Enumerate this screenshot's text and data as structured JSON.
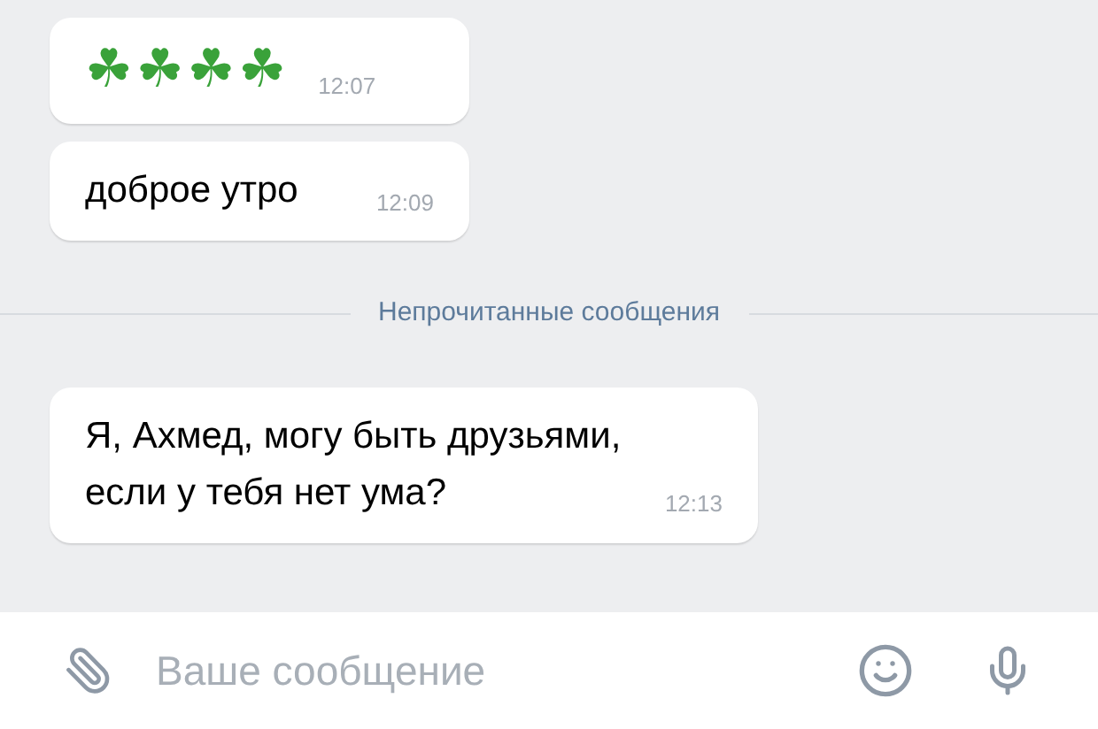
{
  "messages": [
    {
      "text": "☘☘☘☘",
      "time": "12:07",
      "kind": "emoji"
    },
    {
      "text": "доброе утро",
      "time": "12:09",
      "kind": "text"
    }
  ],
  "divider": {
    "label": "Непрочитанные сообщения"
  },
  "unread_messages": [
    {
      "text": "Я, Ахмед, могу быть друзьями, если у тебя нет ума?",
      "time": "12:13",
      "kind": "text"
    }
  ],
  "composer": {
    "placeholder": "Ваше сообщение"
  }
}
